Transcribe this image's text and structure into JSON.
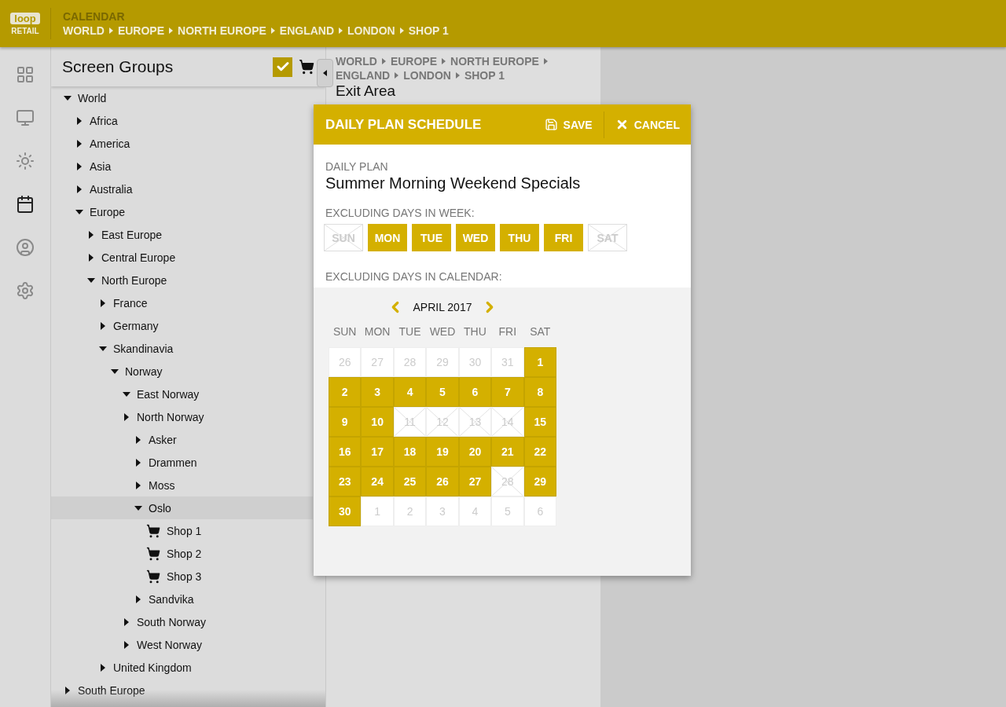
{
  "app": {
    "logo": "loop",
    "logo_sub": "RETAIL",
    "section": "CALENDAR",
    "breadcrumb": [
      "WORLD",
      "EUROPE",
      "NORTH EUROPE",
      "ENGLAND",
      "LONDON",
      "SHOP 1"
    ]
  },
  "nav": [
    {
      "selected": false
    },
    {
      "selected": false
    },
    {
      "selected": false
    },
    {
      "selected": true
    },
    {
      "selected": false
    },
    {
      "selected": false
    }
  ],
  "tree_panel": {
    "title": "Screen Groups",
    "filter_checked": true,
    "items": [
      {
        "label": "World",
        "kind": "folder",
        "expanded": true,
        "selected": false,
        "children": [
          {
            "label": "Africa",
            "kind": "folder",
            "expanded": false,
            "selected": false
          },
          {
            "label": "America",
            "kind": "folder",
            "expanded": false,
            "selected": false
          },
          {
            "label": "Asia",
            "kind": "folder",
            "expanded": false,
            "selected": false
          },
          {
            "label": "Australia",
            "kind": "folder",
            "expanded": false,
            "selected": false
          },
          {
            "label": "Europe",
            "kind": "folder",
            "expanded": true,
            "selected": false,
            "children": [
              {
                "label": "East Europe",
                "kind": "folder",
                "expanded": false,
                "selected": false
              },
              {
                "label": "Central Europe",
                "kind": "folder",
                "expanded": false,
                "selected": false
              },
              {
                "label": "North Europe",
                "kind": "folder",
                "expanded": true,
                "selected": false,
                "children": [
                  {
                    "label": "France",
                    "kind": "folder",
                    "expanded": false,
                    "selected": false
                  },
                  {
                    "label": "Germany",
                    "kind": "folder",
                    "expanded": false,
                    "selected": false
                  },
                  {
                    "label": "Skandinavia",
                    "kind": "folder",
                    "expanded": true,
                    "selected": false,
                    "children": [
                      {
                        "label": "Norway",
                        "kind": "folder",
                        "expanded": true,
                        "selected": false,
                        "children": [
                          {
                            "label": "East Norway",
                            "kind": "folder",
                            "expanded": true,
                            "selected": false
                          },
                          {
                            "label": "North Norway",
                            "kind": "folder",
                            "expanded": false,
                            "selected": false
                          },
                          {
                            "label": "Asker",
                            "kind": "folder",
                            "expanded": false,
                            "selected": false,
                            "indent_under": true
                          },
                          {
                            "label": "Drammen",
                            "kind": "folder",
                            "expanded": false,
                            "selected": false,
                            "indent_under": true
                          },
                          {
                            "label": "Moss",
                            "kind": "folder",
                            "expanded": false,
                            "selected": false,
                            "indent_under": true
                          },
                          {
                            "label": "Oslo",
                            "kind": "folder",
                            "expanded": true,
                            "selected": true,
                            "indent_under": true,
                            "children": [
                              {
                                "label": "Shop 1",
                                "kind": "shop",
                                "selected": false
                              },
                              {
                                "label": "Shop 2",
                                "kind": "shop",
                                "selected": false
                              },
                              {
                                "label": "Shop 3",
                                "kind": "shop",
                                "selected": false
                              }
                            ]
                          },
                          {
                            "label": "Sandvika",
                            "kind": "folder",
                            "expanded": false,
                            "selected": false,
                            "indent_under": true
                          },
                          {
                            "label": "South Norway",
                            "kind": "folder",
                            "expanded": false,
                            "selected": false
                          },
                          {
                            "label": "West Norway",
                            "kind": "folder",
                            "expanded": false,
                            "selected": false
                          }
                        ]
                      }
                    ]
                  },
                  {
                    "label": "United Kingdom",
                    "kind": "folder",
                    "expanded": false,
                    "selected": false
                  }
                ]
              }
            ]
          }
        ]
      },
      {
        "label": "South Europe",
        "kind": "folder",
        "expanded": false,
        "selected": false
      }
    ]
  },
  "content": {
    "breadcrumb": [
      "WORLD",
      "EUROPE",
      "NORTH EUROPE",
      "ENGLAND",
      "LONDON",
      "SHOP 1"
    ],
    "title": "Exit Area"
  },
  "dialog": {
    "title": "DAILY PLAN SCHEDULE",
    "actions": [
      {
        "label": "SAVE",
        "kind": "save"
      },
      {
        "label": "CANCEL",
        "kind": "cancel"
      }
    ],
    "plan_label": "DAILY PLAN",
    "plan_name": "Summer Morning Weekend Specials",
    "week_label": "EXCLUDING DAYS IN WEEK:",
    "week_days": [
      {
        "label": "SUN",
        "excluded": true
      },
      {
        "label": "MON",
        "excluded": false
      },
      {
        "label": "TUE",
        "excluded": false
      },
      {
        "label": "WED",
        "excluded": false
      },
      {
        "label": "THU",
        "excluded": false
      },
      {
        "label": "FRI",
        "excluded": false
      },
      {
        "label": "SAT",
        "excluded": true
      }
    ],
    "calendar_label": "EXCLUDING DAYS IN CALENDAR:",
    "calendar": {
      "month": "APRIL 2017",
      "weekdays": [
        "SUN",
        "MON",
        "TUE",
        "WED",
        "THU",
        "FRI",
        "SAT"
      ],
      "days": [
        {
          "label": "26",
          "kind": "other"
        },
        {
          "label": "27",
          "kind": "other"
        },
        {
          "label": "28",
          "kind": "other"
        },
        {
          "label": "29",
          "kind": "other"
        },
        {
          "label": "30",
          "kind": "other"
        },
        {
          "label": "31",
          "kind": "other"
        },
        {
          "label": "1",
          "kind": "included"
        },
        {
          "label": "2",
          "kind": "included"
        },
        {
          "label": "3",
          "kind": "included"
        },
        {
          "label": "4",
          "kind": "included"
        },
        {
          "label": "5",
          "kind": "included"
        },
        {
          "label": "6",
          "kind": "included"
        },
        {
          "label": "7",
          "kind": "included"
        },
        {
          "label": "8",
          "kind": "included"
        },
        {
          "label": "9",
          "kind": "included"
        },
        {
          "label": "10",
          "kind": "included"
        },
        {
          "label": "11",
          "kind": "excluded"
        },
        {
          "label": "12",
          "kind": "excluded"
        },
        {
          "label": "13",
          "kind": "excluded"
        },
        {
          "label": "14",
          "kind": "excluded"
        },
        {
          "label": "15",
          "kind": "included"
        },
        {
          "label": "16",
          "kind": "included"
        },
        {
          "label": "17",
          "kind": "included"
        },
        {
          "label": "18",
          "kind": "included"
        },
        {
          "label": "19",
          "kind": "included"
        },
        {
          "label": "20",
          "kind": "included"
        },
        {
          "label": "21",
          "kind": "included"
        },
        {
          "label": "22",
          "kind": "included"
        },
        {
          "label": "23",
          "kind": "included"
        },
        {
          "label": "24",
          "kind": "included"
        },
        {
          "label": "25",
          "kind": "included"
        },
        {
          "label": "26",
          "kind": "included"
        },
        {
          "label": "27",
          "kind": "included"
        },
        {
          "label": "28",
          "kind": "excluded"
        },
        {
          "label": "29",
          "kind": "included"
        },
        {
          "label": "30",
          "kind": "included"
        },
        {
          "label": "1",
          "kind": "other"
        },
        {
          "label": "2",
          "kind": "other"
        },
        {
          "label": "3",
          "kind": "other"
        },
        {
          "label": "4",
          "kind": "other"
        },
        {
          "label": "5",
          "kind": "other"
        },
        {
          "label": "6",
          "kind": "other"
        }
      ]
    }
  }
}
